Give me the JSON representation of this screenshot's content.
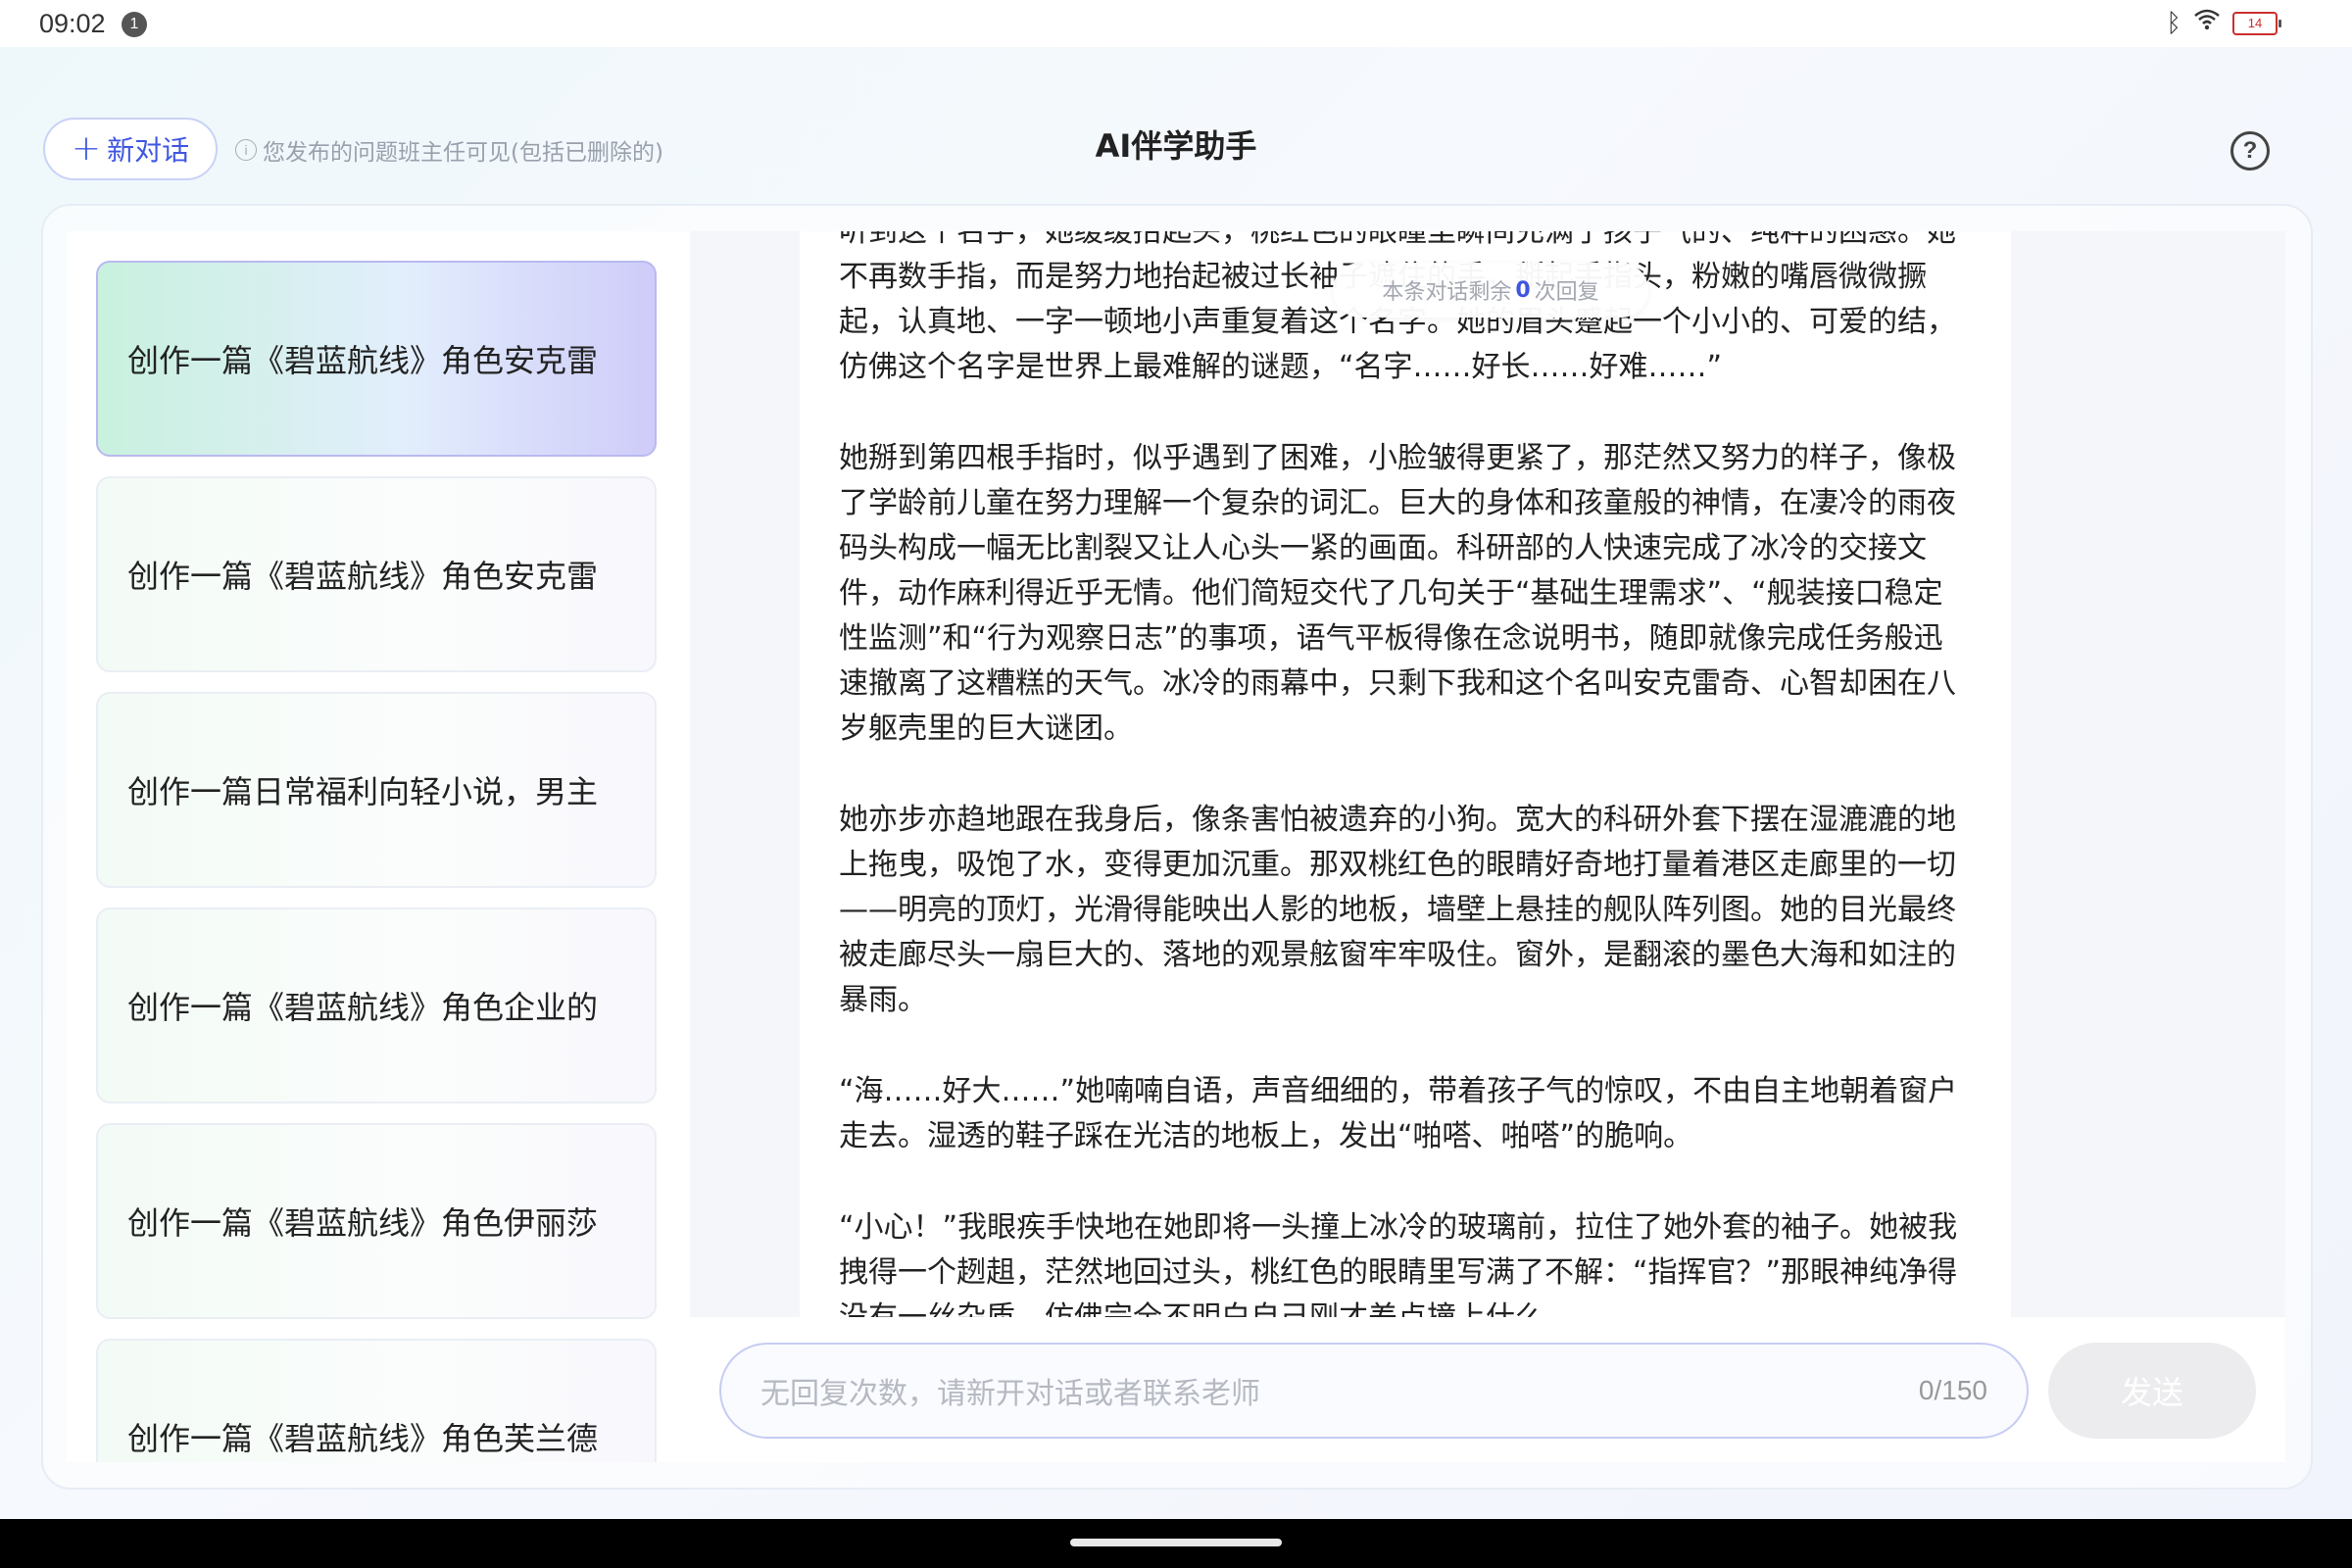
{
  "status_bar": {
    "time": "09:02",
    "notification_count": "1",
    "battery": "14",
    "icons": [
      "bluetooth-icon",
      "wifi-icon",
      "battery-icon"
    ]
  },
  "header": {
    "new_chat_label": "新对话",
    "notice": "您发布的问题班主任可见(包括已删除的)",
    "title": "AI伴学助手",
    "help_icon": "?"
  },
  "sidebar": {
    "items": [
      {
        "label": "创作一篇《碧蓝航线》角色安克雷",
        "active": true
      },
      {
        "label": "创作一篇《碧蓝航线》角色安克雷",
        "active": false
      },
      {
        "label": "创作一篇日常福利向轻小说，男主",
        "active": false
      },
      {
        "label": "创作一篇《碧蓝航线》角色企业的",
        "active": false
      },
      {
        "label": "创作一篇《碧蓝航线》角色伊丽莎",
        "active": false
      },
      {
        "label": "创作一篇《碧蓝航线》角色芙兰德",
        "active": false
      }
    ]
  },
  "chat": {
    "remaining_prefix": "本条对话剩余",
    "remaining_count": "0",
    "remaining_suffix": "次回复",
    "paragraphs": [
      "听到这个名字，她缓缓抬起头，桃红色的眼瞳里瞬间充满了孩子气的、纯粹的困惑。她不再数手指，而是努力地抬起被过长袖子遮住的手，掰起手指头，粉嫩的嘴唇微微撅起，认真地、一字一顿地小声重复着这个名字。她的眉头蹙起一个小小的、可爱的结，仿佛这个名字是世界上最难解的谜题，“名字……好长……好难……”",
      "她掰到第四根手指时，似乎遇到了困难，小脸皱得更紧了，那茫然又努力的样子，像极了学龄前儿童在努力理解一个复杂的词汇。巨大的身体和孩童般的神情，在凄冷的雨夜码头构成一幅无比割裂又让人心头一紧的画面。科研部的人快速完成了冰冷的交接文件，动作麻利得近乎无情。他们简短交代了几句关于“基础生理需求”、“舰装接口稳定性监测”和“行为观察日志”的事项，语气平板得像在念说明书，随即就像完成任务般迅速撤离了这糟糕的天气。冰冷的雨幕中，只剩下我和这个名叫安克雷奇、心智却困在八岁躯壳里的巨大谜团。",
      "她亦步亦趋地跟在我身后，像条害怕被遗弃的小狗。宽大的科研外套下摆在湿漉漉的地上拖曳，吸饱了水，变得更加沉重。那双桃红色的眼睛好奇地打量着港区走廊里的一切——明亮的顶灯，光滑得能映出人影的地板，墙壁上悬挂的舰队阵列图。她的目光最终被走廊尽头一扇巨大的、落地的观景舷窗牢牢吸住。窗外，是翻滚的墨色大海和如注的暴雨。",
      "“海……好大……”她喃喃自语，声音细细的，带着孩子气的惊叹，不由自主地朝着窗户走去。湿透的鞋子踩在光洁的地板上，发出“啪嗒、啪嗒”的脆响。",
      "“小心！”我眼疾手快地在她即将一头撞上冰冷的玻璃前，拉住了她外套的袖子。她被我拽得一个趔趄，茫然地回过头，桃红色的眼睛里写满了不解：“指挥官？”那眼神纯净得没有一丝杂质，仿佛完全不明白自己刚才差点撞上什么。"
    ]
  },
  "input": {
    "placeholder": "无回复次数，请新开对话或者联系老师",
    "counter": "0/150",
    "send_label": "发送"
  },
  "colors": {
    "accent": "#3f56e0",
    "active_item_gradient_start": "#c8f1de",
    "active_item_gradient_end": "#cfccf9"
  }
}
